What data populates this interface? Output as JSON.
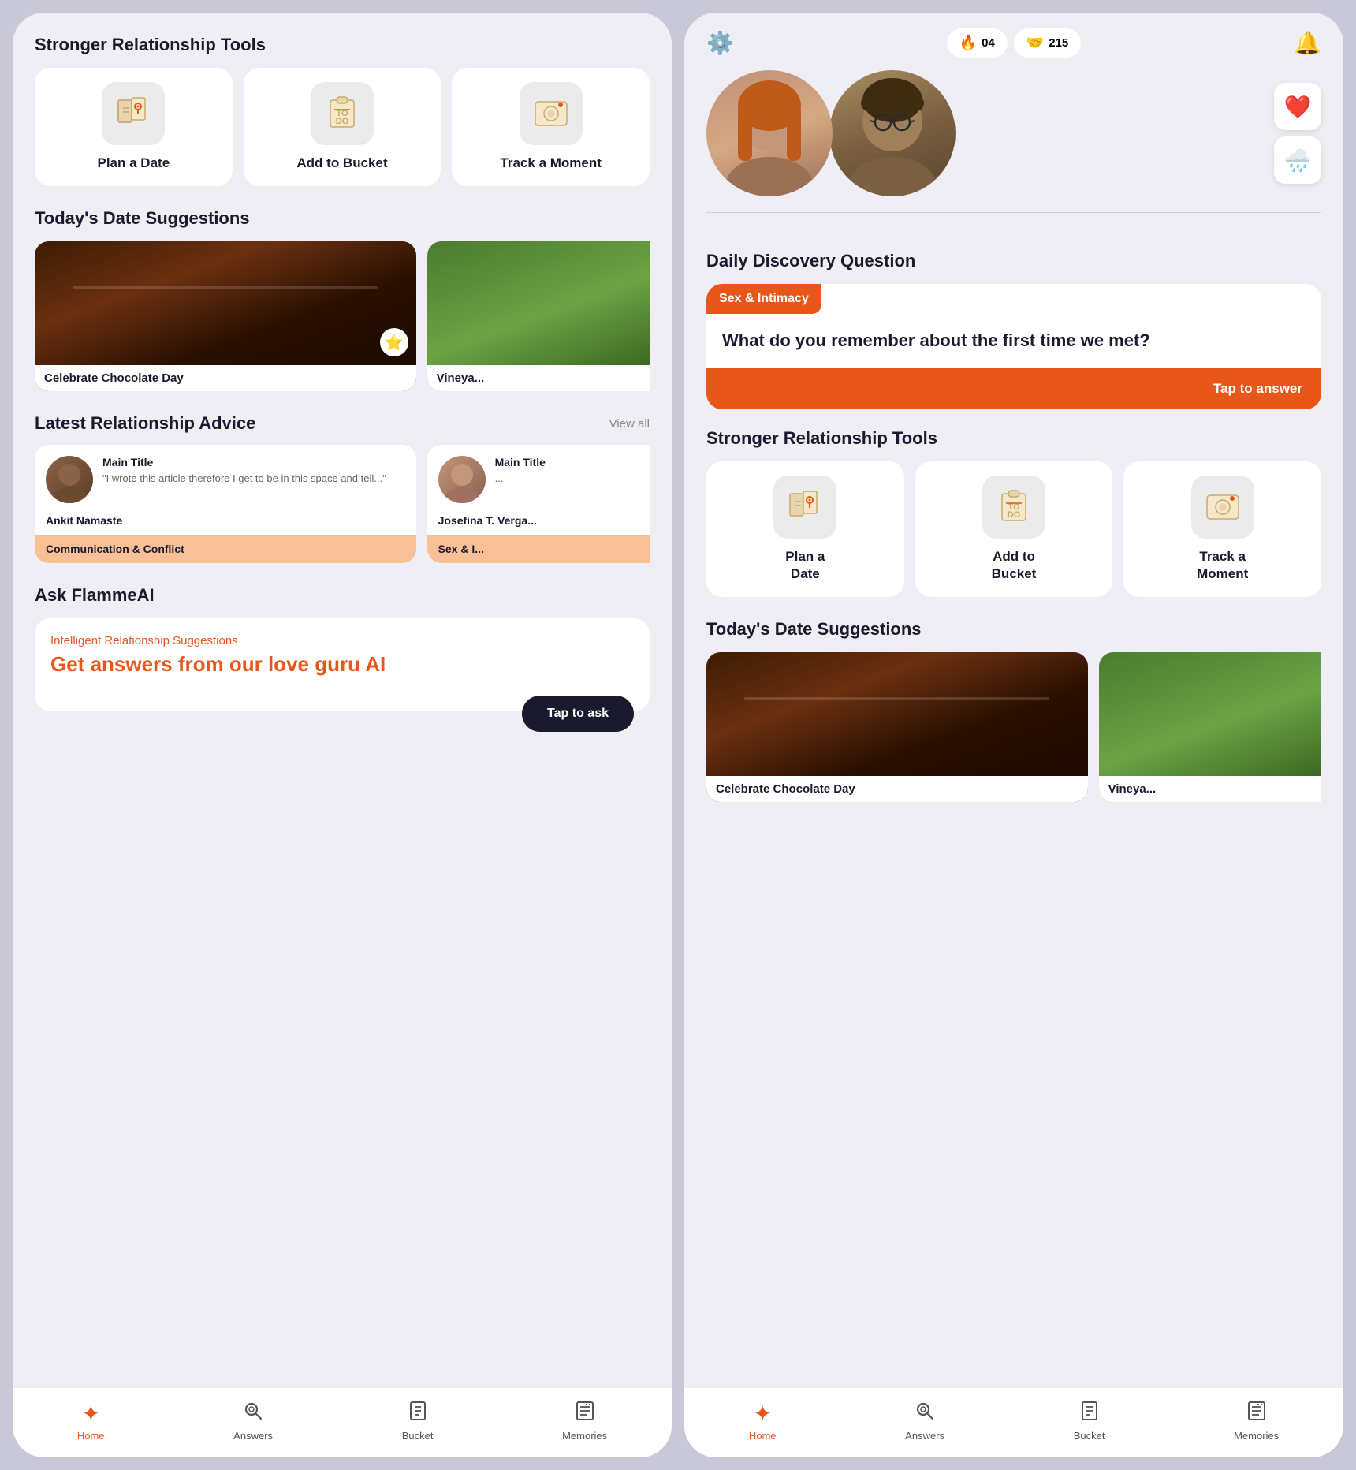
{
  "left_phone": {
    "tools_section_title": "Stronger Relationship Tools",
    "tools": [
      {
        "id": "plan-date",
        "label": "Plan a Date",
        "icon": "map"
      },
      {
        "id": "add-bucket",
        "label": "Add to Bucket",
        "icon": "todo"
      },
      {
        "id": "track-moment",
        "label": "Track a Moment",
        "icon": "photo"
      }
    ],
    "date_suggestions_title": "Today's Date Suggestions",
    "date_suggestions": [
      {
        "label": "Celebrate Chocolate Day",
        "starred": true
      },
      {
        "label": "Vineya..."
      }
    ],
    "advice_section_title": "Latest Relationship Advice",
    "view_all_label": "View all",
    "advice_cards": [
      {
        "main_title": "Main Title",
        "excerpt": "\"I wrote this article therefore I get to be in this space and tell...\"",
        "author": "Ankit Namaste",
        "tag": "Communication & Conflict"
      },
      {
        "main_title": "Main Title",
        "excerpt": "...",
        "author": "Josefina T. Verga...",
        "tag": "Sex & I..."
      }
    ],
    "flamme_section_title": "Ask FlammeAI",
    "flamme_subtitle": "Intelligent Relationship Suggestions",
    "flamme_heading": "Get answers from our love guru AI",
    "flamme_btn_label": "Tap to ask"
  },
  "right_phone": {
    "header": {
      "gear_icon": "⚙",
      "flame_count": "04",
      "heart_count": "215",
      "bell_icon": "🔔"
    },
    "couple": {
      "reaction_heart": "❤️",
      "reaction_cloud": "🌧"
    },
    "discovery_section_title": "Daily Discovery Question",
    "discovery_tag": "Sex & Intimacy",
    "discovery_question": "What do you remember about the first time we met?",
    "discovery_btn": "Tap to answer",
    "tools_section_title": "Stronger Relationship Tools",
    "tools": [
      {
        "id": "plan-date-r",
        "label": "Plan a\nDate",
        "label_line1": "Plan a",
        "label_line2": "Date",
        "icon": "map"
      },
      {
        "id": "add-bucket-r",
        "label": "Add to\nBucket",
        "label_line1": "Add to",
        "label_line2": "Bucket",
        "icon": "todo"
      },
      {
        "id": "track-moment-r",
        "label": "Track a\nMoment",
        "label_line1": "Track a",
        "label_line2": "Moment",
        "icon": "photo"
      }
    ],
    "date_suggestions_title": "Today's Date Suggestions"
  },
  "bottom_nav": {
    "items": [
      {
        "id": "home",
        "label": "Home",
        "icon": "✦",
        "active": true
      },
      {
        "id": "answers",
        "label": "Answers",
        "icon": "🔍"
      },
      {
        "id": "bucket",
        "label": "Bucket",
        "icon": "📋"
      },
      {
        "id": "memories",
        "label": "Memories",
        "icon": "📝"
      }
    ]
  }
}
